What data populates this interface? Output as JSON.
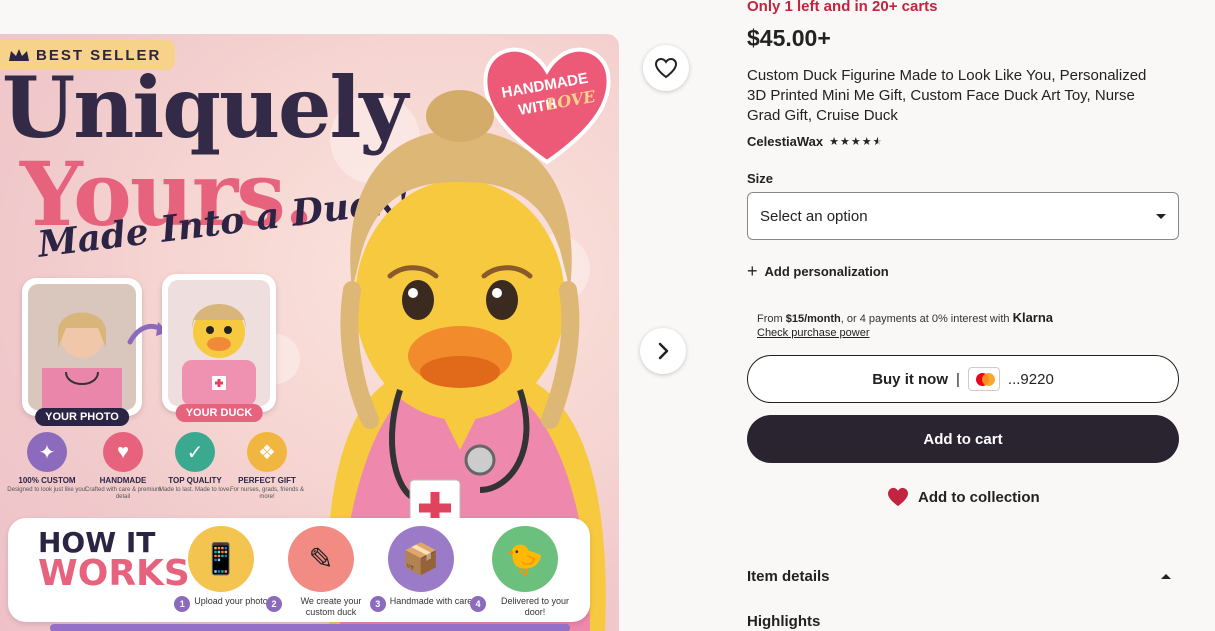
{
  "listing": {
    "stock_notice": "Only 1 left and in 20+ carts",
    "price": "$45.00+",
    "title": "Custom Duck Figurine Made to Look Like You, Personalized 3D Printed Mini Me Gift, Custom Face Duck Art Toy, Nurse Grad Gift, Cruise Duck",
    "shop_name": "CelestiaWax",
    "rating": 4.5
  },
  "image": {
    "badge": "BEST SELLER",
    "headline_1": "Uniquely",
    "headline_2": "Yours.",
    "headline_3": "Made Into a Duck!",
    "heart_tag_1": "HANDMADE",
    "heart_tag_2": "WITH",
    "heart_tag_3": "LOVE",
    "photo_label": "YOUR PHOTO",
    "duck_label": "YOUR DUCK",
    "features": [
      {
        "icon": "magic-wand-icon",
        "title": "100% CUSTOM",
        "sub": "Designed to look just like you!",
        "color": "#8c6bbd"
      },
      {
        "icon": "heart-icon",
        "title": "HANDMADE",
        "sub": "Crafted with care & premium detail",
        "color": "#e7637d"
      },
      {
        "icon": "shield-check-icon",
        "title": "TOP QUALITY",
        "sub": "Made to last. Made to love.",
        "color": "#3aa98f"
      },
      {
        "icon": "gift-icon",
        "title": "PERFECT GIFT",
        "sub": "For nurses, grads, friends & more!",
        "color": "#f1b640"
      }
    ],
    "how_title_1": "HOW IT",
    "how_title_2": "WORKS",
    "steps": [
      {
        "n": "1",
        "text": "Upload your photo",
        "icon": "phone-icon",
        "color": "#f3c44f"
      },
      {
        "n": "2",
        "text": "We create your custom duck",
        "icon": "drawing-icon",
        "color": "#f28b84"
      },
      {
        "n": "3",
        "text": "Handmade with care",
        "icon": "box-icon",
        "color": "#9b7bc8"
      },
      {
        "n": "4",
        "text": "Delivered to your door!",
        "icon": "duck-icon",
        "color": "#6cc07d"
      }
    ]
  },
  "options": {
    "size_label": "Size",
    "size_placeholder": "Select an option",
    "add_personalization": "Add personalization"
  },
  "klarna": {
    "from": "From ",
    "amount": "$15/month",
    "middle": ", or 4 payments at 0% interest with ",
    "brand": "Klarna",
    "check": "Check purchase power"
  },
  "buttons": {
    "buy_now": "Buy it now",
    "card_suffix": "...9220",
    "add_to_cart": "Add to cart",
    "add_to_collection": "Add to collection"
  },
  "sections": {
    "item_details": "Item details",
    "highlights": "Highlights"
  },
  "colors": {
    "stock_red": "#c2233e",
    "cart_dark": "#2a2430",
    "heart_red": "#c2233e"
  }
}
